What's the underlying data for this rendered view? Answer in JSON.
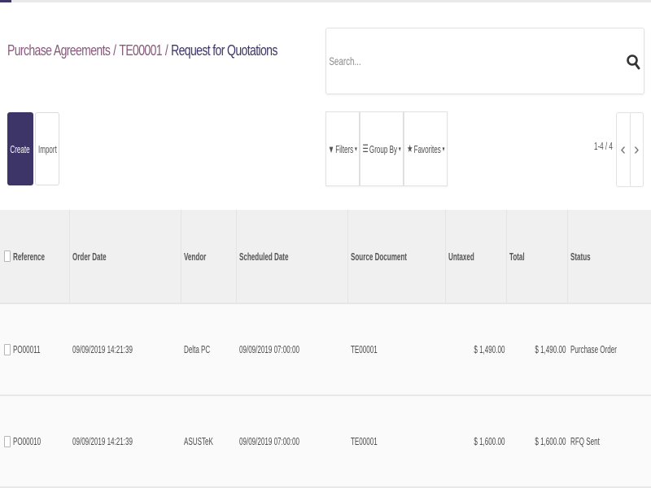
{
  "breadcrumb": {
    "item1": "Purchase Agreements",
    "sep": "/",
    "item2": "TE00001",
    "current": "Request for Quotations"
  },
  "search": {
    "placeholder": "Search..."
  },
  "buttons": {
    "create": "Create",
    "import": "Import"
  },
  "filters": {
    "filters_label": "Filters",
    "group_by_label": "Group By",
    "favorites_label": "Favorites"
  },
  "pager": {
    "value": "1-4 / 4",
    "prev": "‹",
    "next": "›"
  },
  "table": {
    "headers": [
      "Reference",
      "Order Date",
      "Vendor",
      "Scheduled Date",
      "Source Document",
      "Untaxed",
      "Total",
      "Status"
    ],
    "rows": [
      [
        "PO00011",
        "09/09/2019 14:21:39",
        "Delta PC",
        "09/09/2019 07:00:00",
        "TE00001",
        "$ 1,490.00",
        "$ 1,490.00",
        "Purchase Order"
      ],
      [
        "PO00010",
        "09/09/2019 14:21:39",
        "ASUSTeK",
        "09/09/2019 07:00:00",
        "TE00001",
        "$ 1,600.00",
        "$ 1,600.00",
        "RFQ Sent"
      ]
    ]
  },
  "colors": {
    "primary": "#3d3568",
    "breadcrumb_link": "#875a7b",
    "header_bg": "#f0f0f0"
  },
  "icons": {
    "search": "search-icon",
    "filter": "filter-icon",
    "group_by": "group-by-icon",
    "favorites": "star-icon",
    "prev": "chevron-left-icon",
    "next": "chevron-right-icon"
  }
}
